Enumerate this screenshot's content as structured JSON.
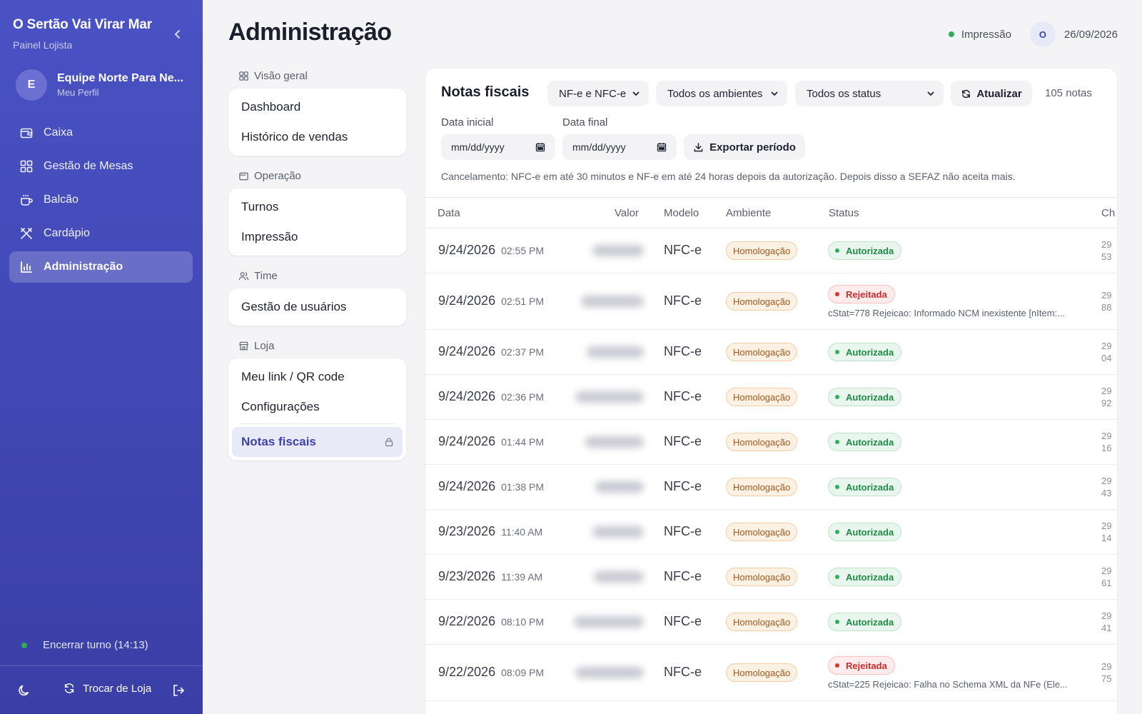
{
  "sidebar": {
    "store_name": "O Sertão Vai Virar Mar",
    "subtitle": "Painel Lojista",
    "profile": {
      "initial": "E",
      "name": "Equipe Norte Para Ne...",
      "link": "Meu Perfil"
    },
    "nav": [
      {
        "label": "Caixa",
        "icon": "wallet-icon"
      },
      {
        "label": "Gestão de Mesas",
        "icon": "grid-icon"
      },
      {
        "label": "Balcão",
        "icon": "coffee-icon"
      },
      {
        "label": "Cardápio",
        "icon": "utensils-icon"
      },
      {
        "label": "Administração",
        "icon": "chart-icon",
        "active": true
      }
    ],
    "shift_label": "Encerrar turno (14:13)",
    "switch_store": "Trocar de Loja"
  },
  "header": {
    "title": "Administração",
    "printer_status": "Impressão",
    "user_initial": "O",
    "date": "26/09/2026"
  },
  "subnav": {
    "sections": [
      {
        "label": "Visão geral",
        "items": [
          "Dashboard",
          "Histórico de vendas"
        ]
      },
      {
        "label": "Operação",
        "items": [
          "Turnos",
          "Impressão"
        ]
      },
      {
        "label": "Time",
        "items": [
          "Gestão de usuários"
        ]
      },
      {
        "label": "Loja",
        "items": [
          "Meu link / QR code",
          "Configurações"
        ],
        "active_item": "Notas fiscais"
      }
    ]
  },
  "panel": {
    "title": "Notas fiscais",
    "filter_model": "NF-e e NFC-e",
    "filter_env": "Todos os ambientes",
    "filter_status": "Todos os status",
    "refresh": "Atualizar",
    "count": "105 notas",
    "date_start_label": "Data inicial",
    "date_end_label": "Data final",
    "date_placeholder": "mm/dd/yyyy",
    "export": "Exportar período",
    "notice": "Cancelamento: NFC-e em até 30 minutos e NF-e em até 24 horas depois da autorização. Depois disso a SEFAZ não aceita mais.",
    "columns": {
      "date": "Data",
      "value": "Valor",
      "model": "Modelo",
      "env": "Ambiente",
      "status": "Status",
      "key": "Ch"
    },
    "rows": [
      {
        "date": "9/24/2026",
        "time": "02:55 PM",
        "model": "NFC-e",
        "env": "Homologação",
        "status": "Autorizada",
        "key1": "29",
        "key2": "53"
      },
      {
        "date": "9/24/2026",
        "time": "02:51 PM",
        "model": "NFC-e",
        "env": "Homologação",
        "status": "Rejeitada",
        "reason": "cStat=778 Rejeicao: Informado NCM inexistente [nItem:...",
        "key1": "29",
        "key2": "88"
      },
      {
        "date": "9/24/2026",
        "time": "02:37 PM",
        "model": "NFC-e",
        "env": "Homologação",
        "status": "Autorizada",
        "key1": "29",
        "key2": "04"
      },
      {
        "date": "9/24/2026",
        "time": "02:36 PM",
        "model": "NFC-e",
        "env": "Homologação",
        "status": "Autorizada",
        "key1": "29",
        "key2": "92"
      },
      {
        "date": "9/24/2026",
        "time": "01:44 PM",
        "model": "NFC-e",
        "env": "Homologação",
        "status": "Autorizada",
        "key1": "29",
        "key2": "16"
      },
      {
        "date": "9/24/2026",
        "time": "01:38 PM",
        "model": "NFC-e",
        "env": "Homologação",
        "status": "Autorizada",
        "key1": "29",
        "key2": "43"
      },
      {
        "date": "9/23/2026",
        "time": "11:40 AM",
        "model": "NFC-e",
        "env": "Homologação",
        "status": "Autorizada",
        "key1": "29",
        "key2": "14"
      },
      {
        "date": "9/23/2026",
        "time": "11:39 AM",
        "model": "NFC-e",
        "env": "Homologação",
        "status": "Autorizada",
        "key1": "29",
        "key2": "61"
      },
      {
        "date": "9/22/2026",
        "time": "08:10 PM",
        "model": "NFC-e",
        "env": "Homologação",
        "status": "Autorizada",
        "key1": "29",
        "key2": "41"
      },
      {
        "date": "9/22/2026",
        "time": "08:09 PM",
        "model": "NFC-e",
        "env": "Homologação",
        "status": "Rejeitada",
        "reason": "cStat=225 Rejeicao: Falha no Schema XML da NFe (Ele...",
        "key1": "29",
        "key2": "75"
      }
    ]
  },
  "colors": {
    "sidebar": "#4a52c4",
    "accent": "#3d43a8",
    "ok": "#1f8a46",
    "rejected": "#c92c2c",
    "env": "#a2581b"
  }
}
